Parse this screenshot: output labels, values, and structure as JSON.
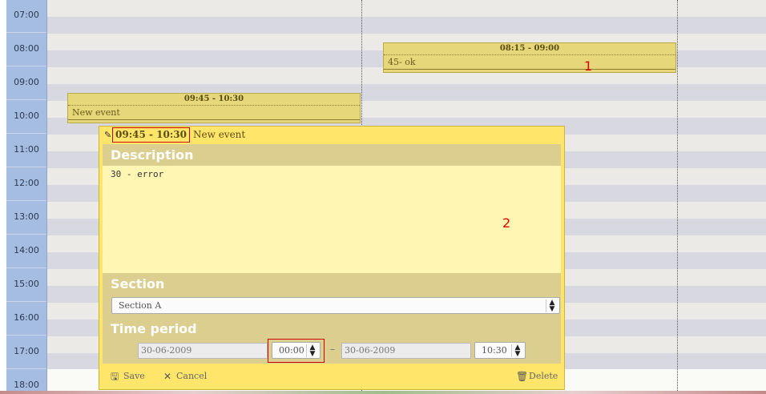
{
  "time_column": {
    "hours": [
      "07:00",
      "08:00",
      "09:00",
      "10:00",
      "11:00",
      "12:00",
      "13:00",
      "14:00",
      "15:00",
      "16:00",
      "17:00",
      "18:00"
    ]
  },
  "events": [
    {
      "time": "08:15 - 09:00",
      "text": "45- ok"
    },
    {
      "time": "09:45 - 10:30",
      "text": "New event"
    }
  ],
  "markers": {
    "one": "1",
    "two": "2"
  },
  "editor": {
    "header_time": "09:45 - 10:30",
    "header_title": "New event",
    "description_label": "Description",
    "description_value": "30 - error",
    "section_label": "Section",
    "section_value": "Section A",
    "time_label": "Time period",
    "start_date": "30-06-2009",
    "start_time": "00:00",
    "separator": "–",
    "end_date": "30-06-2009",
    "end_time": "10:30",
    "save_label": "Save",
    "cancel_label": "Cancel",
    "delete_label": "Delete"
  },
  "icons": {
    "pencil": "pencil-icon",
    "save": "save-icon",
    "cancel": "cancel-icon",
    "delete": "delete-icon",
    "spinner": "spinner-icon"
  },
  "colors": {
    "event_fill": "#e6d77a",
    "editor_bg": "#ffe56a",
    "time_column": "#a4bde0",
    "highlight": "#d00000"
  }
}
